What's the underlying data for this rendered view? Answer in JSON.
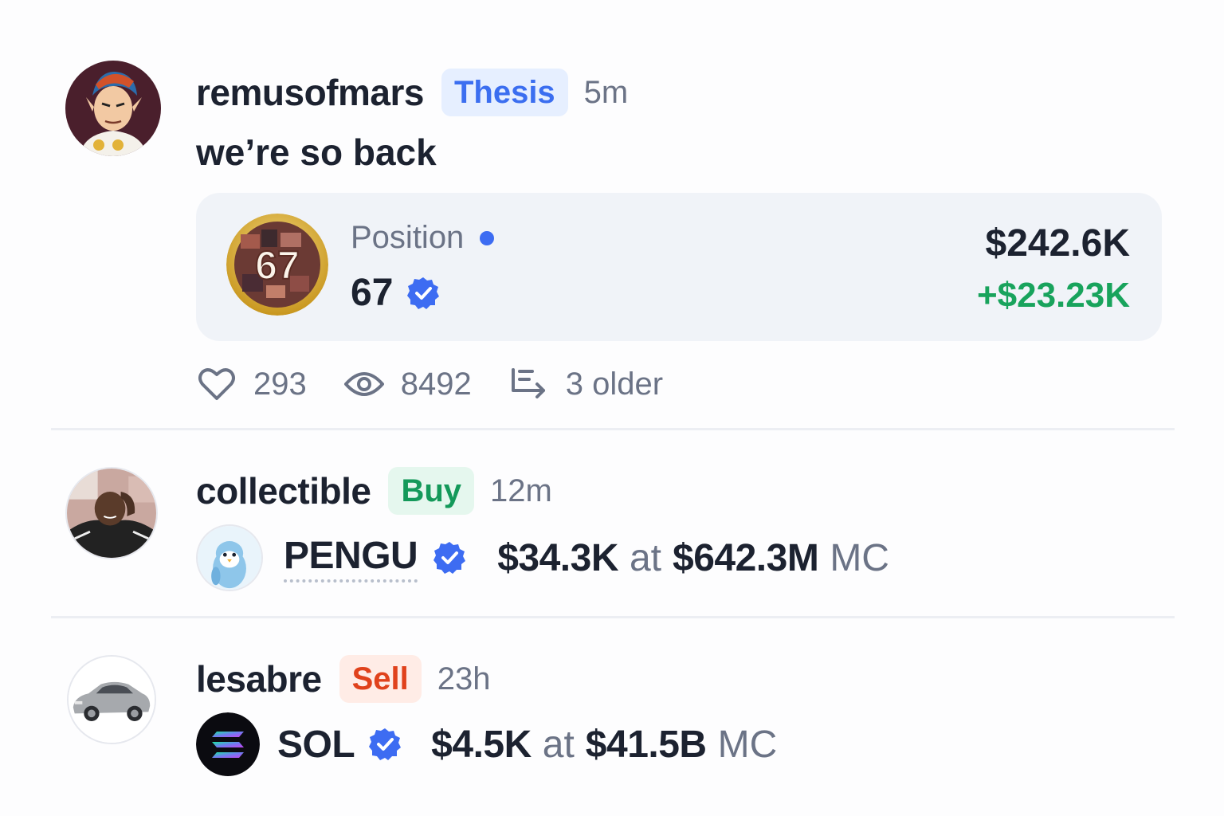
{
  "colors": {
    "thesis_bg": "#e6efff",
    "thesis_fg": "#3b6ef0",
    "buy_bg": "#e5f7ee",
    "buy_fg": "#14995a",
    "sell_bg": "#ffece6",
    "sell_fg": "#e0421c",
    "pnl_positive": "#18a35c",
    "verified": "#3d6cf2",
    "muted": "#6b7386"
  },
  "posts": [
    {
      "username": "remusofmars",
      "tag": "Thesis",
      "time": "5m",
      "text": "we’re so back",
      "position": {
        "label": "Position",
        "token": "67",
        "token_image_text": "67",
        "value": "$242.6K",
        "pnl": "+$23.23K"
      },
      "stats": {
        "likes": "293",
        "views": "8492",
        "older": "3 older"
      }
    },
    {
      "username": "collectible",
      "tag": "Buy",
      "time": "12m",
      "trade": {
        "symbol": "PENGU",
        "amount": "$34.3K",
        "at": "at",
        "mc_value": "$642.3M",
        "mc_label": "MC"
      }
    },
    {
      "username": "lesabre",
      "tag": "Sell",
      "time": "23h",
      "trade": {
        "symbol": "SOL",
        "amount": "$4.5K",
        "at": "at",
        "mc_value": "$41.5B",
        "mc_label": "MC"
      }
    }
  ]
}
